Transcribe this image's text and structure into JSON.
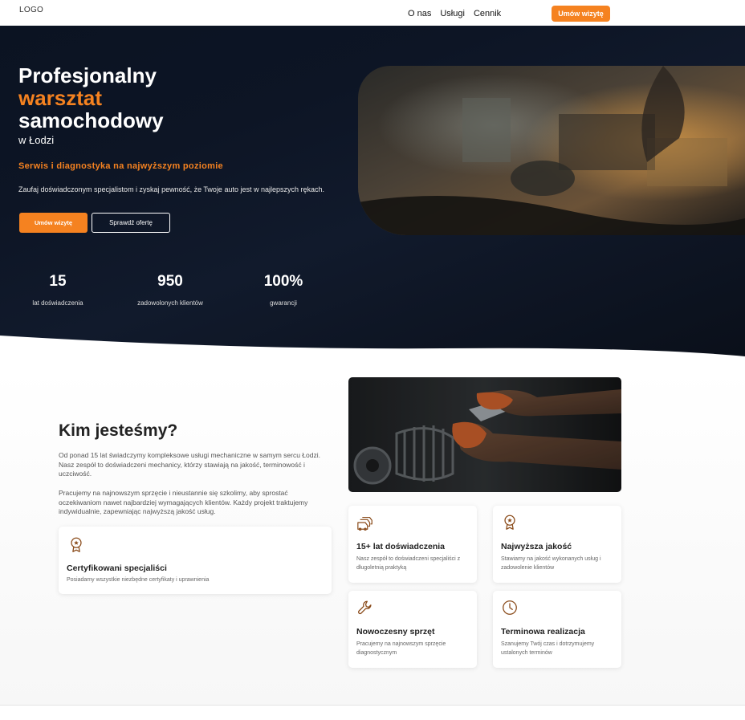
{
  "header": {
    "logo": "LOGO",
    "nav": [
      "O nas",
      "Usługi",
      "Cennik"
    ],
    "cta": "Umów wizytę"
  },
  "hero": {
    "title_line1": "Profesjonalny",
    "title_accent": "warsztat",
    "title_line3": "samochodowy",
    "subtitle": "w Łodzi",
    "tagline": "Serwis i diagnostyka na najwyższym poziomie",
    "description": "Zaufaj doświadczonym specjalistom i zyskaj pewność, że Twoje auto jest w najlepszych rękach.",
    "btn_primary": "Umów wizytę",
    "btn_secondary": "Sprawdź ofertę",
    "stats": [
      {
        "num": "15",
        "label": "lat doświadczenia"
      },
      {
        "num": "950",
        "label": "zadowolonych klientów"
      },
      {
        "num": "100%",
        "label": "gwarancji"
      }
    ]
  },
  "about": {
    "title": "Kim jesteśmy?",
    "p1": "Od ponad 15 lat świadczymy kompleksowe usługi mechaniczne w samym sercu Łodzi. Nasz zespół to doświadczeni mechanicy, którzy stawiają na jakość, terminowość i uczciwość.",
    "p2": "Pracujemy na najnowszym sprzęcie i nieustannie się szkolimy, aby sprostać oczekiwaniom nawet najbardziej wymagających klientów. Każdy projekt traktujemy indywidualnie, zapewniając najwyższą jakość usług.",
    "cert": {
      "title": "Certyfikowani specjaliści",
      "desc": "Posiadamy wszystkie niezbędne certyfikaty i uprawnienia",
      "icon": "award-icon"
    },
    "features": [
      {
        "title": "15+ lat doświadczenia",
        "desc": "Nasz zespół to doświadczeni specjaliści z długoletnią praktyką",
        "icon": "cars-icon"
      },
      {
        "title": "Najwyższa jakość",
        "desc": "Stawiamy na jakość wykonanych usług i zadowolenie klientów",
        "icon": "award-icon"
      },
      {
        "title": "Nowoczesny sprzęt",
        "desc": "Pracujemy na najnowszym sprzęcie diagnostycznym",
        "icon": "wrench-icon"
      },
      {
        "title": "Terminowa realizacja",
        "desc": "Szanujemy Twój czas i dotrzymujemy ustalonych terminów",
        "icon": "clock-icon"
      }
    ]
  },
  "colors": {
    "accent": "#f58220",
    "dark": "#0d1525",
    "icon": "#8a4b1a"
  }
}
